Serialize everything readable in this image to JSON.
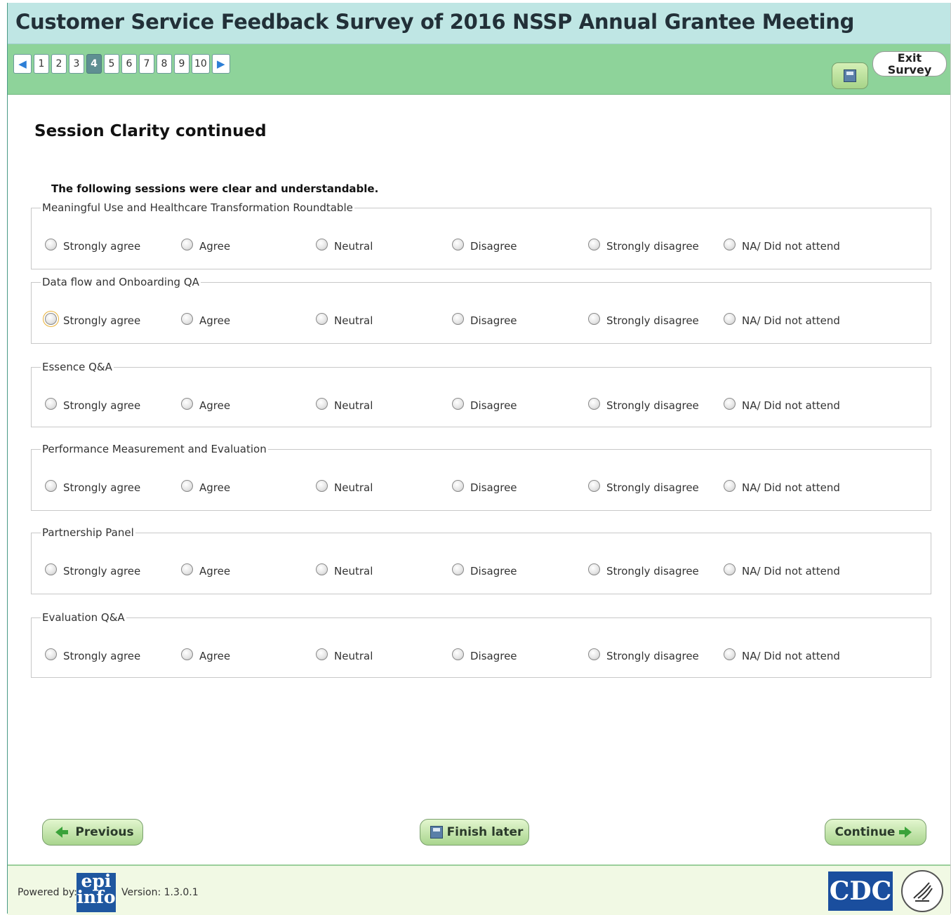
{
  "window": {
    "title": "Customer Service Feedback Survey of 2016 NSSP Annual Grantee Meeting"
  },
  "pager": {
    "prev_icon": "triangle-left-icon",
    "next_icon": "triangle-right-icon",
    "pages": [
      "1",
      "2",
      "3",
      "4",
      "5",
      "6",
      "7",
      "8",
      "9",
      "10"
    ],
    "current": "4"
  },
  "toolbar": {
    "save_icon": "floppy-disk-icon",
    "exit_label_line1": "Exit",
    "exit_label_line2": "Survey"
  },
  "section": {
    "title": "Session Clarity continued",
    "instruction": "The following sessions were clear and understandable."
  },
  "options": [
    "Strongly agree",
    "Agree",
    "Neutral",
    "Disagree",
    "Strongly disagree",
    "NA/ Did not attend"
  ],
  "questions": [
    {
      "label": "Meaningful Use and Healthcare Transformation Roundtable",
      "selected": null
    },
    {
      "label": "Data flow and Onboarding QA",
      "selected": null,
      "focused_option": "Strongly agree"
    },
    {
      "label": "Essence Q&A",
      "selected": null
    },
    {
      "label": "Performance Measurement and Evaluation",
      "selected": null
    },
    {
      "label": "Partnership Panel",
      "selected": null
    },
    {
      "label": "Evaluation Q&A",
      "selected": null
    }
  ],
  "buttons": {
    "previous": "Previous",
    "finish_later": "Finish later",
    "continue": "Continue"
  },
  "footer": {
    "powered_by": "Powered by:",
    "epi_logo_line1": "epi",
    "epi_logo_line2": "info",
    "version": "Version: 1.3.0.1",
    "cdc_logo": "CDC",
    "hhs_icon": "hhs-eagle-icon"
  }
}
